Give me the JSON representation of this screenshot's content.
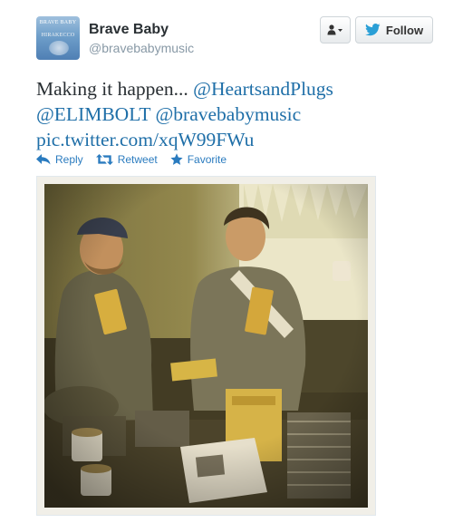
{
  "user": {
    "name": "Brave Baby",
    "handle": "@bravebabymusic",
    "avatar_text_top": "BRAVE BABY",
    "avatar_text_mid": "HIRAKECCO"
  },
  "buttons": {
    "follow_label": "Follow",
    "user_menu_icon": "user-dropdown-icon",
    "follow_icon": "twitter-bird-icon"
  },
  "tweet": {
    "text_plain": "Making it happen... ",
    "mentions": [
      "@HeartsandPlugs",
      "@ELIMBOLT",
      "@bravebabymusic"
    ],
    "pic_link": "pic.twitter.com/xqW99FWu"
  },
  "actions": [
    {
      "label": "Reply",
      "icon": "reply-arrow-icon"
    },
    {
      "label": "Retweet",
      "icon": "retweet-icon"
    },
    {
      "label": "Favorite",
      "icon": "star-icon"
    }
  ],
  "colors": {
    "link": "#1f6fa8",
    "action": "#2a7bbf",
    "handle": "#8899a6",
    "button_border": "#cfd5d9"
  }
}
